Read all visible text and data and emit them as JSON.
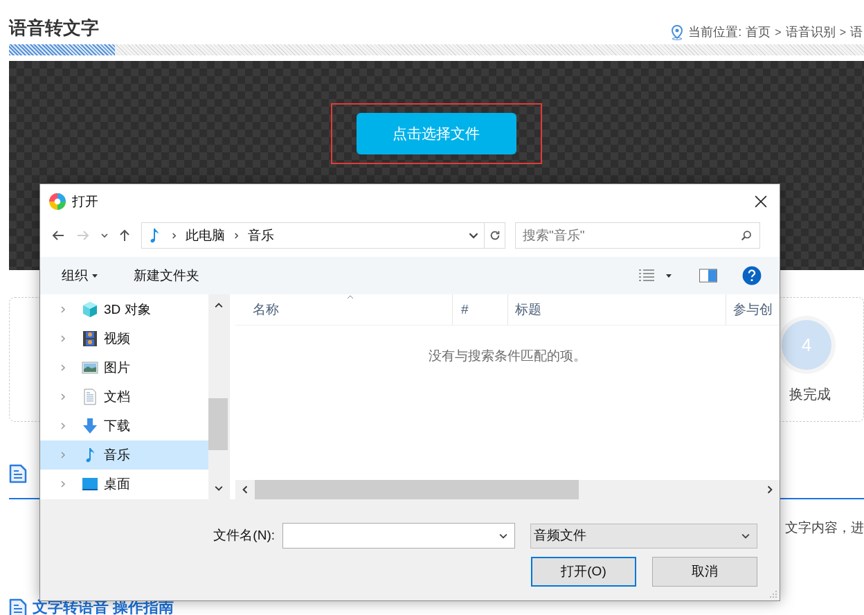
{
  "page": {
    "title": "语音转文字",
    "breadcrumb": {
      "label": "当前位置:",
      "separator": ">",
      "items": [
        "首页",
        "语音识别",
        "语"
      ]
    },
    "upload_button": "点击选择文件",
    "steps": [
      {
        "number": "4",
        "label": "换完成"
      }
    ],
    "paragraph_fragment": "文字内容，进",
    "section_heading": "文字转语音 操作指南"
  },
  "dialog": {
    "title": "打开",
    "path": [
      "此电脑",
      "音乐"
    ],
    "search_placeholder": "搜索\"音乐\"",
    "toolbar": {
      "organize": "组织",
      "new_folder": "新建文件夹"
    },
    "tree": [
      {
        "label": "3D 对象",
        "kind": "cube",
        "selected": false
      },
      {
        "label": "视频",
        "kind": "film",
        "selected": false
      },
      {
        "label": "图片",
        "kind": "image",
        "selected": false
      },
      {
        "label": "文档",
        "kind": "document",
        "selected": false
      },
      {
        "label": "下载",
        "kind": "download",
        "selected": false
      },
      {
        "label": "音乐",
        "kind": "music",
        "selected": true
      },
      {
        "label": "桌面",
        "kind": "desktop",
        "selected": false
      }
    ],
    "columns": [
      "名称",
      "#",
      "标题",
      "参与创"
    ],
    "empty_message": "没有与搜索条件匹配的项。",
    "filename_label": "文件名(N):",
    "file_type": "音频文件",
    "buttons": [
      {
        "label": "打开(O)",
        "default": true
      },
      {
        "label": "取消",
        "default": false
      }
    ]
  }
}
